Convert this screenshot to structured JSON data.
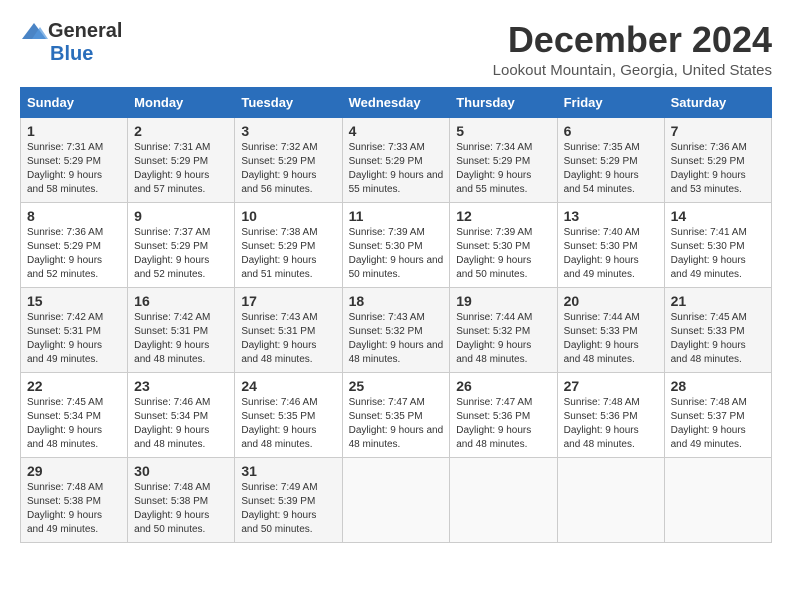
{
  "logo": {
    "general": "General",
    "blue": "Blue"
  },
  "title": {
    "month": "December 2024",
    "location": "Lookout Mountain, Georgia, United States"
  },
  "weekdays": [
    "Sunday",
    "Monday",
    "Tuesday",
    "Wednesday",
    "Thursday",
    "Friday",
    "Saturday"
  ],
  "weeks": [
    [
      {
        "day": "1",
        "sunrise": "Sunrise: 7:31 AM",
        "sunset": "Sunset: 5:29 PM",
        "daylight": "Daylight: 9 hours and 58 minutes."
      },
      {
        "day": "2",
        "sunrise": "Sunrise: 7:31 AM",
        "sunset": "Sunset: 5:29 PM",
        "daylight": "Daylight: 9 hours and 57 minutes."
      },
      {
        "day": "3",
        "sunrise": "Sunrise: 7:32 AM",
        "sunset": "Sunset: 5:29 PM",
        "daylight": "Daylight: 9 hours and 56 minutes."
      },
      {
        "day": "4",
        "sunrise": "Sunrise: 7:33 AM",
        "sunset": "Sunset: 5:29 PM",
        "daylight": "Daylight: 9 hours and 55 minutes."
      },
      {
        "day": "5",
        "sunrise": "Sunrise: 7:34 AM",
        "sunset": "Sunset: 5:29 PM",
        "daylight": "Daylight: 9 hours and 55 minutes."
      },
      {
        "day": "6",
        "sunrise": "Sunrise: 7:35 AM",
        "sunset": "Sunset: 5:29 PM",
        "daylight": "Daylight: 9 hours and 54 minutes."
      },
      {
        "day": "7",
        "sunrise": "Sunrise: 7:36 AM",
        "sunset": "Sunset: 5:29 PM",
        "daylight": "Daylight: 9 hours and 53 minutes."
      }
    ],
    [
      {
        "day": "8",
        "sunrise": "Sunrise: 7:36 AM",
        "sunset": "Sunset: 5:29 PM",
        "daylight": "Daylight: 9 hours and 52 minutes."
      },
      {
        "day": "9",
        "sunrise": "Sunrise: 7:37 AM",
        "sunset": "Sunset: 5:29 PM",
        "daylight": "Daylight: 9 hours and 52 minutes."
      },
      {
        "day": "10",
        "sunrise": "Sunrise: 7:38 AM",
        "sunset": "Sunset: 5:29 PM",
        "daylight": "Daylight: 9 hours and 51 minutes."
      },
      {
        "day": "11",
        "sunrise": "Sunrise: 7:39 AM",
        "sunset": "Sunset: 5:30 PM",
        "daylight": "Daylight: 9 hours and 50 minutes."
      },
      {
        "day": "12",
        "sunrise": "Sunrise: 7:39 AM",
        "sunset": "Sunset: 5:30 PM",
        "daylight": "Daylight: 9 hours and 50 minutes."
      },
      {
        "day": "13",
        "sunrise": "Sunrise: 7:40 AM",
        "sunset": "Sunset: 5:30 PM",
        "daylight": "Daylight: 9 hours and 49 minutes."
      },
      {
        "day": "14",
        "sunrise": "Sunrise: 7:41 AM",
        "sunset": "Sunset: 5:30 PM",
        "daylight": "Daylight: 9 hours and 49 minutes."
      }
    ],
    [
      {
        "day": "15",
        "sunrise": "Sunrise: 7:42 AM",
        "sunset": "Sunset: 5:31 PM",
        "daylight": "Daylight: 9 hours and 49 minutes."
      },
      {
        "day": "16",
        "sunrise": "Sunrise: 7:42 AM",
        "sunset": "Sunset: 5:31 PM",
        "daylight": "Daylight: 9 hours and 48 minutes."
      },
      {
        "day": "17",
        "sunrise": "Sunrise: 7:43 AM",
        "sunset": "Sunset: 5:31 PM",
        "daylight": "Daylight: 9 hours and 48 minutes."
      },
      {
        "day": "18",
        "sunrise": "Sunrise: 7:43 AM",
        "sunset": "Sunset: 5:32 PM",
        "daylight": "Daylight: 9 hours and 48 minutes."
      },
      {
        "day": "19",
        "sunrise": "Sunrise: 7:44 AM",
        "sunset": "Sunset: 5:32 PM",
        "daylight": "Daylight: 9 hours and 48 minutes."
      },
      {
        "day": "20",
        "sunrise": "Sunrise: 7:44 AM",
        "sunset": "Sunset: 5:33 PM",
        "daylight": "Daylight: 9 hours and 48 minutes."
      },
      {
        "day": "21",
        "sunrise": "Sunrise: 7:45 AM",
        "sunset": "Sunset: 5:33 PM",
        "daylight": "Daylight: 9 hours and 48 minutes."
      }
    ],
    [
      {
        "day": "22",
        "sunrise": "Sunrise: 7:45 AM",
        "sunset": "Sunset: 5:34 PM",
        "daylight": "Daylight: 9 hours and 48 minutes."
      },
      {
        "day": "23",
        "sunrise": "Sunrise: 7:46 AM",
        "sunset": "Sunset: 5:34 PM",
        "daylight": "Daylight: 9 hours and 48 minutes."
      },
      {
        "day": "24",
        "sunrise": "Sunrise: 7:46 AM",
        "sunset": "Sunset: 5:35 PM",
        "daylight": "Daylight: 9 hours and 48 minutes."
      },
      {
        "day": "25",
        "sunrise": "Sunrise: 7:47 AM",
        "sunset": "Sunset: 5:35 PM",
        "daylight": "Daylight: 9 hours and 48 minutes."
      },
      {
        "day": "26",
        "sunrise": "Sunrise: 7:47 AM",
        "sunset": "Sunset: 5:36 PM",
        "daylight": "Daylight: 9 hours and 48 minutes."
      },
      {
        "day": "27",
        "sunrise": "Sunrise: 7:48 AM",
        "sunset": "Sunset: 5:36 PM",
        "daylight": "Daylight: 9 hours and 48 minutes."
      },
      {
        "day": "28",
        "sunrise": "Sunrise: 7:48 AM",
        "sunset": "Sunset: 5:37 PM",
        "daylight": "Daylight: 9 hours and 49 minutes."
      }
    ],
    [
      {
        "day": "29",
        "sunrise": "Sunrise: 7:48 AM",
        "sunset": "Sunset: 5:38 PM",
        "daylight": "Daylight: 9 hours and 49 minutes."
      },
      {
        "day": "30",
        "sunrise": "Sunrise: 7:48 AM",
        "sunset": "Sunset: 5:38 PM",
        "daylight": "Daylight: 9 hours and 50 minutes."
      },
      {
        "day": "31",
        "sunrise": "Sunrise: 7:49 AM",
        "sunset": "Sunset: 5:39 PM",
        "daylight": "Daylight: 9 hours and 50 minutes."
      },
      null,
      null,
      null,
      null
    ]
  ]
}
